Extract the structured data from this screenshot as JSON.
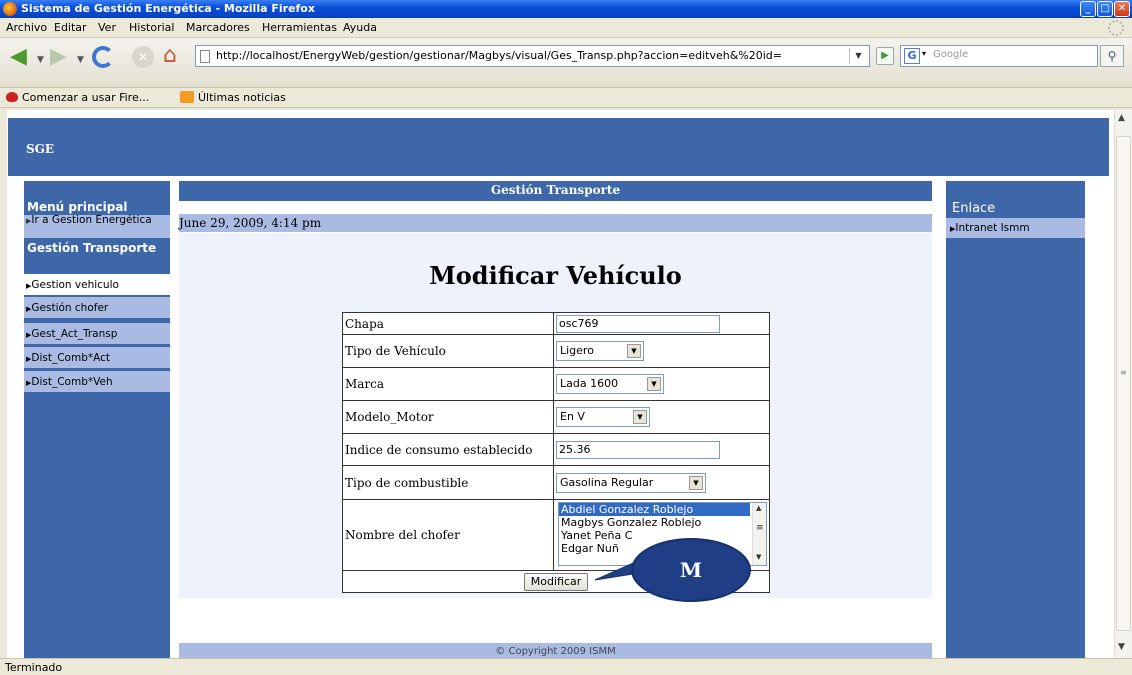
{
  "window": {
    "title": "Sistema de Gestión Energética - Mozilla Firefox",
    "minimize": "_",
    "maximize": "□",
    "close": "✕"
  },
  "menubar": [
    "Archivo",
    "Editar",
    "Ver",
    "Historial",
    "Marcadores",
    "Herramientas",
    "Ayuda"
  ],
  "navbar": {
    "url": "http://localhost/EnergyWeb/gestion/gestionar/Magbys/visual/Ges_Transp.php?accion=editveh&%20id=",
    "search_placeholder": "Google"
  },
  "bookmarks": [
    "Comenzar a usar Fire...",
    "Últimas noticias"
  ],
  "page": {
    "site_title": "SGE",
    "left_menu": {
      "title": "Menú principal",
      "link_energy": "Ir a Gestion Energética",
      "section": "Gestión Transporte",
      "items": [
        "Gestion vehiculo",
        "Gestión chofer",
        "Gest_Act_Transp",
        "Dist_Comb*Act",
        "Dist_Comb*Veh"
      ]
    },
    "main_header": "Gestión Transporte",
    "date": "June 29, 2009, 4:14 pm",
    "heading": "Modificar Vehículo",
    "form": {
      "chapa_label": "Chapa",
      "chapa_value": "osc769",
      "tipo_label": "Tipo de Vehículo",
      "tipo_value": "Ligero",
      "marca_label": "Marca",
      "marca_value": "Lada 1600",
      "modelo_label": "Modelo_Motor",
      "modelo_value": "En V",
      "indice_label": "Indice de consumo establecido",
      "indice_value": "25.36",
      "combustible_label": "Tipo de combustible",
      "combustible_value": "Gasolina Regular",
      "chofer_label": "Nombre del chofer",
      "chofer_options": [
        "Abdiel Gonzalez Roblejo",
        "Magbys Gonzalez Roblejo",
        "Yanet Peña C",
        "Edgar Nuñ"
      ],
      "submit": "Modificar"
    },
    "footer": "© Copyright 2009 ISMM",
    "right_menu": {
      "title": "Enlace",
      "link": "Intranet Ismm"
    }
  },
  "callout": "M",
  "status": "Terminado"
}
